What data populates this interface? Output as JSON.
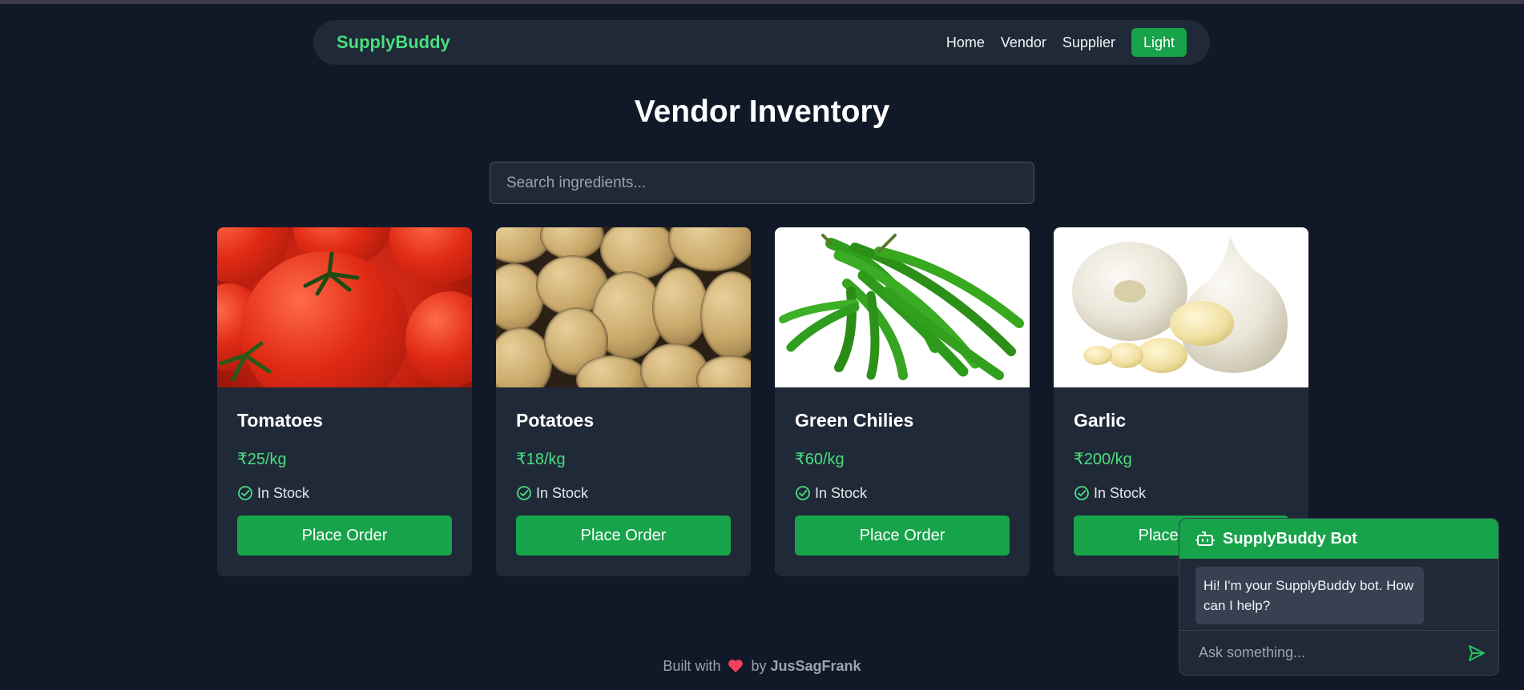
{
  "navbar": {
    "brand": "SupplyBuddy",
    "links": [
      "Home",
      "Vendor",
      "Supplier"
    ],
    "theme_button": "Light"
  },
  "page": {
    "title": "Vendor Inventory"
  },
  "search": {
    "placeholder": "Search ingredients..."
  },
  "products": [
    {
      "name": "Tomatoes",
      "price": "₹25/kg",
      "stock": "In Stock",
      "button": "Place Order"
    },
    {
      "name": "Potatoes",
      "price": "₹18/kg",
      "stock": "In Stock",
      "button": "Place Order"
    },
    {
      "name": "Green Chilies",
      "price": "₹60/kg",
      "stock": "In Stock",
      "button": "Place Order"
    },
    {
      "name": "Garlic",
      "price": "₹200/kg",
      "stock": "In Stock",
      "button": "Place Order"
    }
  ],
  "footer": {
    "prefix": "Built with",
    "by": "by",
    "author": "JusSagFrank"
  },
  "chatbot": {
    "title": "SupplyBuddy Bot",
    "greeting": "Hi! I'm your SupplyBuddy bot. How can I help?",
    "input_placeholder": "Ask something..."
  },
  "colors": {
    "background": "#111827",
    "surface": "#1f2937",
    "accent": "#16a34a",
    "accent_text": "#4ade80",
    "heart": "#f43f5e"
  }
}
